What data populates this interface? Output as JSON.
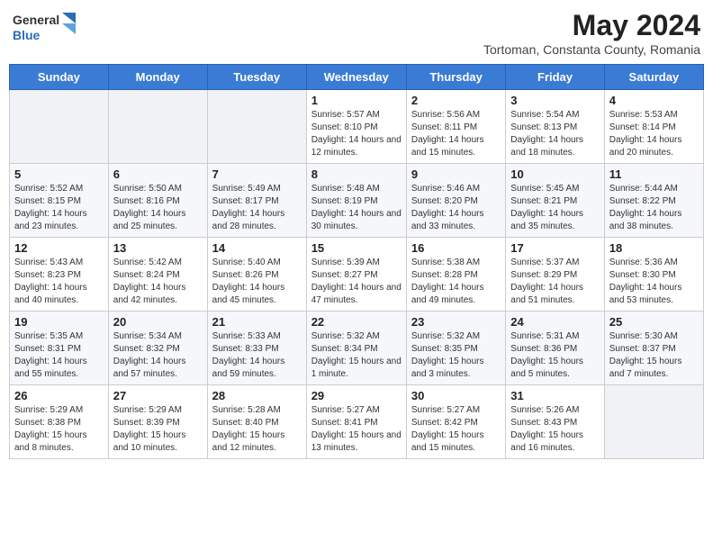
{
  "header": {
    "logo": {
      "general": "General",
      "blue": "Blue"
    },
    "month_year": "May 2024",
    "location": "Tortoman, Constanta County, Romania"
  },
  "weekdays": [
    "Sunday",
    "Monday",
    "Tuesday",
    "Wednesday",
    "Thursday",
    "Friday",
    "Saturday"
  ],
  "weeks": [
    [
      {
        "day": "",
        "info": ""
      },
      {
        "day": "",
        "info": ""
      },
      {
        "day": "",
        "info": ""
      },
      {
        "day": "1",
        "info": "Sunrise: 5:57 AM\nSunset: 8:10 PM\nDaylight: 14 hours and 12 minutes."
      },
      {
        "day": "2",
        "info": "Sunrise: 5:56 AM\nSunset: 8:11 PM\nDaylight: 14 hours and 15 minutes."
      },
      {
        "day": "3",
        "info": "Sunrise: 5:54 AM\nSunset: 8:13 PM\nDaylight: 14 hours and 18 minutes."
      },
      {
        "day": "4",
        "info": "Sunrise: 5:53 AM\nSunset: 8:14 PM\nDaylight: 14 hours and 20 minutes."
      }
    ],
    [
      {
        "day": "5",
        "info": "Sunrise: 5:52 AM\nSunset: 8:15 PM\nDaylight: 14 hours and 23 minutes."
      },
      {
        "day": "6",
        "info": "Sunrise: 5:50 AM\nSunset: 8:16 PM\nDaylight: 14 hours and 25 minutes."
      },
      {
        "day": "7",
        "info": "Sunrise: 5:49 AM\nSunset: 8:17 PM\nDaylight: 14 hours and 28 minutes."
      },
      {
        "day": "8",
        "info": "Sunrise: 5:48 AM\nSunset: 8:19 PM\nDaylight: 14 hours and 30 minutes."
      },
      {
        "day": "9",
        "info": "Sunrise: 5:46 AM\nSunset: 8:20 PM\nDaylight: 14 hours and 33 minutes."
      },
      {
        "day": "10",
        "info": "Sunrise: 5:45 AM\nSunset: 8:21 PM\nDaylight: 14 hours and 35 minutes."
      },
      {
        "day": "11",
        "info": "Sunrise: 5:44 AM\nSunset: 8:22 PM\nDaylight: 14 hours and 38 minutes."
      }
    ],
    [
      {
        "day": "12",
        "info": "Sunrise: 5:43 AM\nSunset: 8:23 PM\nDaylight: 14 hours and 40 minutes."
      },
      {
        "day": "13",
        "info": "Sunrise: 5:42 AM\nSunset: 8:24 PM\nDaylight: 14 hours and 42 minutes."
      },
      {
        "day": "14",
        "info": "Sunrise: 5:40 AM\nSunset: 8:26 PM\nDaylight: 14 hours and 45 minutes."
      },
      {
        "day": "15",
        "info": "Sunrise: 5:39 AM\nSunset: 8:27 PM\nDaylight: 14 hours and 47 minutes."
      },
      {
        "day": "16",
        "info": "Sunrise: 5:38 AM\nSunset: 8:28 PM\nDaylight: 14 hours and 49 minutes."
      },
      {
        "day": "17",
        "info": "Sunrise: 5:37 AM\nSunset: 8:29 PM\nDaylight: 14 hours and 51 minutes."
      },
      {
        "day": "18",
        "info": "Sunrise: 5:36 AM\nSunset: 8:30 PM\nDaylight: 14 hours and 53 minutes."
      }
    ],
    [
      {
        "day": "19",
        "info": "Sunrise: 5:35 AM\nSunset: 8:31 PM\nDaylight: 14 hours and 55 minutes."
      },
      {
        "day": "20",
        "info": "Sunrise: 5:34 AM\nSunset: 8:32 PM\nDaylight: 14 hours and 57 minutes."
      },
      {
        "day": "21",
        "info": "Sunrise: 5:33 AM\nSunset: 8:33 PM\nDaylight: 14 hours and 59 minutes."
      },
      {
        "day": "22",
        "info": "Sunrise: 5:32 AM\nSunset: 8:34 PM\nDaylight: 15 hours and 1 minute."
      },
      {
        "day": "23",
        "info": "Sunrise: 5:32 AM\nSunset: 8:35 PM\nDaylight: 15 hours and 3 minutes."
      },
      {
        "day": "24",
        "info": "Sunrise: 5:31 AM\nSunset: 8:36 PM\nDaylight: 15 hours and 5 minutes."
      },
      {
        "day": "25",
        "info": "Sunrise: 5:30 AM\nSunset: 8:37 PM\nDaylight: 15 hours and 7 minutes."
      }
    ],
    [
      {
        "day": "26",
        "info": "Sunrise: 5:29 AM\nSunset: 8:38 PM\nDaylight: 15 hours and 8 minutes."
      },
      {
        "day": "27",
        "info": "Sunrise: 5:29 AM\nSunset: 8:39 PM\nDaylight: 15 hours and 10 minutes."
      },
      {
        "day": "28",
        "info": "Sunrise: 5:28 AM\nSunset: 8:40 PM\nDaylight: 15 hours and 12 minutes."
      },
      {
        "day": "29",
        "info": "Sunrise: 5:27 AM\nSunset: 8:41 PM\nDaylight: 15 hours and 13 minutes."
      },
      {
        "day": "30",
        "info": "Sunrise: 5:27 AM\nSunset: 8:42 PM\nDaylight: 15 hours and 15 minutes."
      },
      {
        "day": "31",
        "info": "Sunrise: 5:26 AM\nSunset: 8:43 PM\nDaylight: 15 hours and 16 minutes."
      },
      {
        "day": "",
        "info": ""
      }
    ]
  ]
}
